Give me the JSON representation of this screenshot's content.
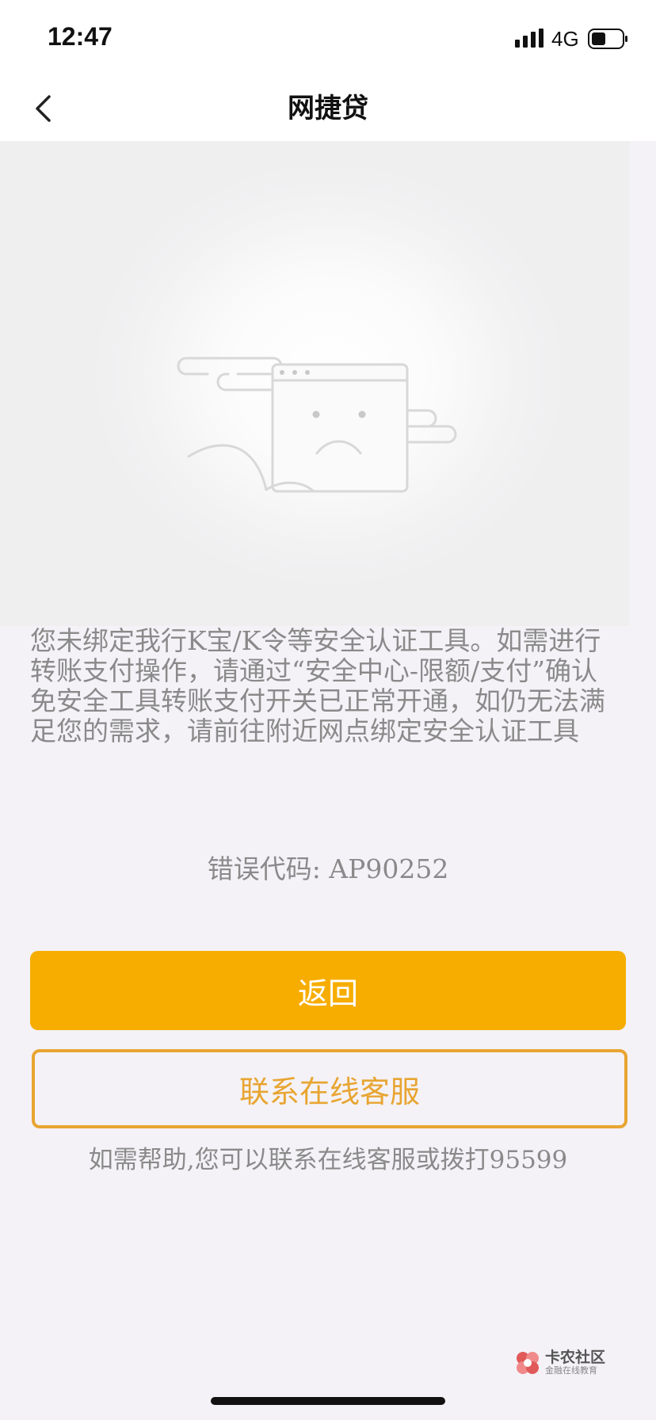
{
  "status_bar": {
    "time": "12:47",
    "network": "4G",
    "icons": [
      "signal-icon",
      "battery-icon"
    ]
  },
  "nav": {
    "title": "网捷贷",
    "back_icon": "chevron-left-icon"
  },
  "illustration": {
    "icon": "sad-browser-window-icon"
  },
  "message": {
    "lines": [
      "您未绑定我行K宝/K令等安全认证工具。如需进行",
      "转账支付操作，请通过“安全中心-限额/支付”确认",
      "免安全工具转账支付开关已正常开通，如仍无法满",
      "足您的需求，请前往附近网点绑定安全认证工具"
    ]
  },
  "error": {
    "code_text": "错误代码: AP90252"
  },
  "buttons": {
    "return_label": "返回",
    "contact_label": "联系在线客服"
  },
  "help": {
    "text": "如需帮助,您可以联系在线客服或拨打95599"
  },
  "watermark": {
    "title": "卡农社区",
    "subtitle": "金融在线教育"
  },
  "colors": {
    "accent": "#f7ad00",
    "outline": "#e8a532",
    "text_muted": "#8a8a8a",
    "background": "#f4f2f7"
  }
}
